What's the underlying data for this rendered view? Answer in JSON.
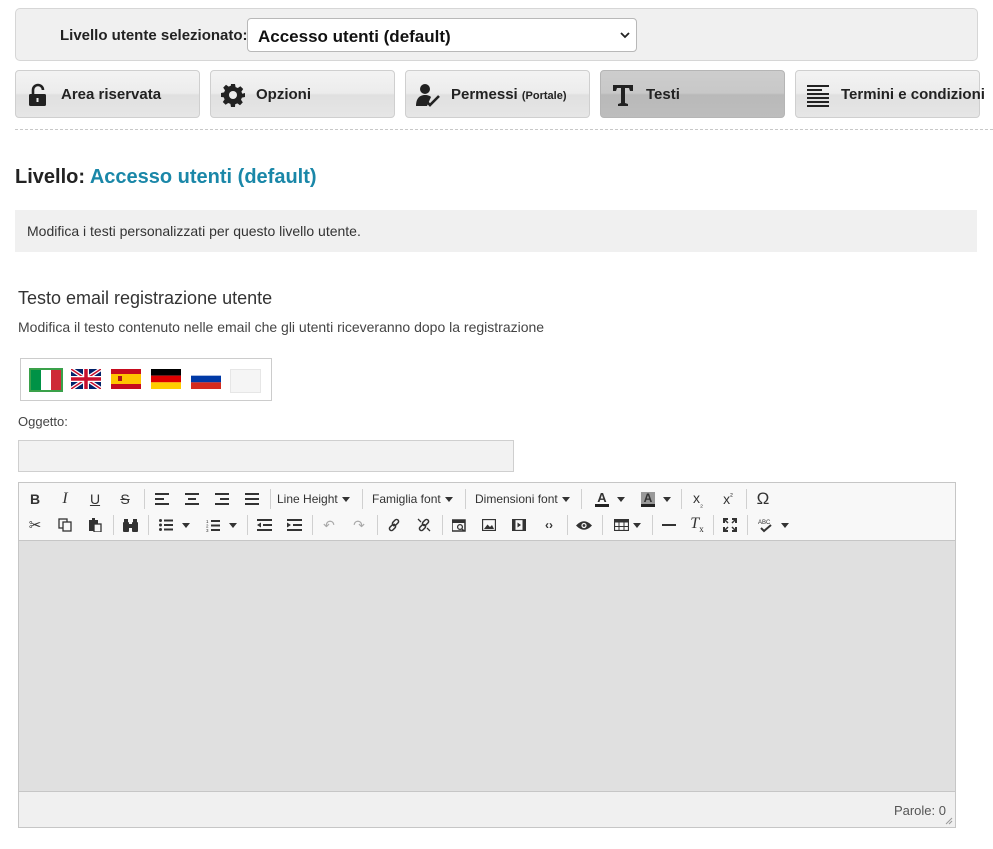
{
  "level_selector": {
    "label": "Livello utente selezionato:",
    "selected": "Accesso utenti (default)"
  },
  "tabs": [
    {
      "label": "Area riservata",
      "suffix": "",
      "icon": "lock-icon",
      "active": false
    },
    {
      "label": "Opzioni",
      "suffix": "",
      "icon": "gear-icon",
      "active": false
    },
    {
      "label": "Permessi",
      "suffix": "(Portale)",
      "icon": "user-check-icon",
      "active": false
    },
    {
      "label": "Testi",
      "suffix": "",
      "icon": "text-t-icon",
      "active": true
    },
    {
      "label": "Termini e condizioni",
      "suffix": "",
      "icon": "lines-icon",
      "active": false
    }
  ],
  "level_heading": {
    "prefix": "Livello:",
    "name": "Accesso utenti (default)"
  },
  "info": "Modifica i testi personalizzati per questo livello utente.",
  "section": {
    "title": "Testo email registrazione utente",
    "description": "Modifica il testo contenuto nelle email che gli utenti riceveranno dopo la registrazione"
  },
  "languages": [
    "it",
    "en",
    "es",
    "de",
    "ru",
    "empty"
  ],
  "subject": {
    "label": "Oggetto:",
    "value": ""
  },
  "editor": {
    "line_height_label": "Line Height",
    "font_family_label": "Famiglia font",
    "font_size_label": "Dimensioni font",
    "word_count": "Parole: 0"
  },
  "colors": {
    "accent": "#1a87a8",
    "panel_bg": "#f0f0f0",
    "editor_bg": "#e0e0e0"
  }
}
